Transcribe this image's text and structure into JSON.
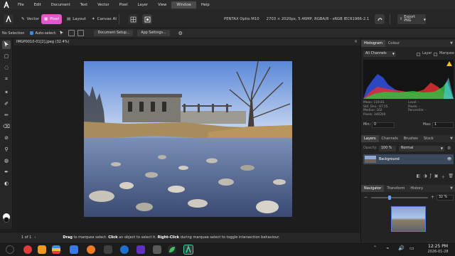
{
  "menubar": {
    "items": [
      "File",
      "Edit",
      "Document",
      "Text",
      "Vector",
      "Pixel",
      "Layer",
      "View",
      "Window",
      "Help"
    ],
    "active_item": "Window"
  },
  "toolbar": {
    "personas": [
      "Vector",
      "Pixel",
      "Layout",
      "Canvas AI"
    ],
    "active_persona": "Pixel",
    "camera": "PENTAX Optio M10",
    "doc_spec": "2703 × 2020px, 5.46MP, RGBA/8 - sRGB IEC61966-2.1",
    "export_label": "Export PNG"
  },
  "contextbar": {
    "selection": "No Selection",
    "auto_select_label": "Auto-select:",
    "document_setup": "Document Setup...",
    "app_settings": "App Settings..."
  },
  "document": {
    "tab_title": "IMGP0010-01[2].jpeg (32.4%)",
    "close": "×"
  },
  "statusbar": {
    "page": "1 of 1",
    "hint_drag": "Drag",
    "hint_1": " to marquee select. ",
    "hint_click": "Click",
    "hint_2": " an object to select it. ",
    "hint_rclick": "Right-Click",
    "hint_3": " during marquee select to toggle intersection behaviour."
  },
  "histogram": {
    "tabs": [
      "Histogram",
      "Colour"
    ],
    "channel": "All Channels",
    "layer_label": "Layer",
    "marquee_label": "Marquee",
    "stats_left": "Mean: 119.81\nStd. Dev.: 67.55\nMedian: 102\nPixels: 340200",
    "stats_right": "Level: -\nPixels: -\nPercentile: -",
    "min_label": "Min:",
    "min_value": "0",
    "max_label": "Max:",
    "max_value": "1",
    "colors": {
      "red": "#e03030",
      "green": "#30c040",
      "blue": "#3050e0",
      "warning": "#f0c020"
    }
  },
  "layers": {
    "tabs": [
      "Layers",
      "Channels",
      "Brushes",
      "Stock"
    ],
    "opacity_label": "Opacity:",
    "opacity": "100 %",
    "blend_mode": "Normal",
    "items": [
      {
        "name": "Background"
      }
    ]
  },
  "navigator": {
    "tabs": [
      "Navigator",
      "Transform",
      "History"
    ],
    "zoom": "32 %",
    "zoom_fraction": 0.32
  },
  "taskbar": {
    "time": "12:25 PM",
    "date": "2026-01-28"
  },
  "accent": "#e357c9"
}
